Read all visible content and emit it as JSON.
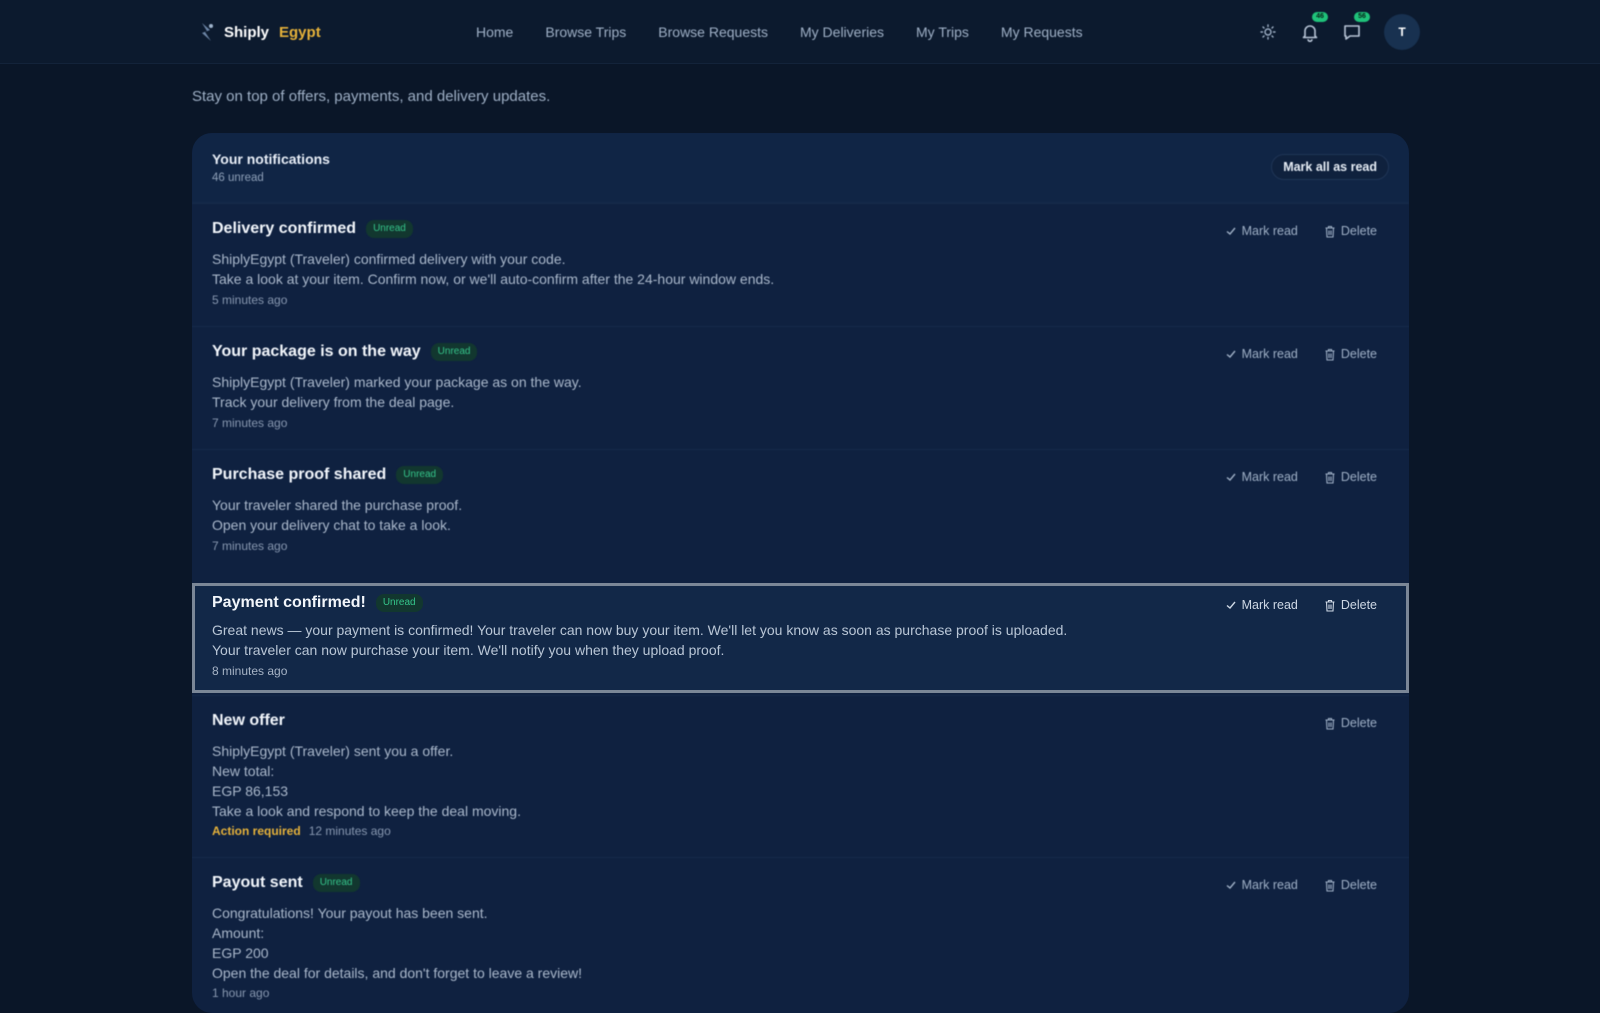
{
  "brand": {
    "name": "Shiply",
    "accent": "Egypt"
  },
  "nav": [
    "Home",
    "Browse Trips",
    "Browse Requests",
    "My Deliveries",
    "My Trips",
    "My Requests"
  ],
  "header": {
    "notification_count": "46",
    "message_count": "56",
    "avatar_initial": "T"
  },
  "page": {
    "subtitle": "Stay on top of offers, payments, and delivery updates."
  },
  "panel": {
    "title": "Your notifications",
    "unread_summary": "46 unread",
    "mark_all_label": "Mark all as read"
  },
  "labels": {
    "mark_read": "Mark read",
    "delete": "Delete",
    "unread": "Unread",
    "action_required": "Action required"
  },
  "notifications": [
    {
      "title": "Delivery confirmed",
      "unread": true,
      "lines": [
        "ShiplyEgypt (Traveler) confirmed delivery with your code.",
        "Take a look at your item. Confirm now, or we'll auto-confirm after the 24-hour window ends."
      ],
      "time": "5 minutes ago"
    },
    {
      "title": "Your package is on the way",
      "unread": true,
      "lines": [
        "ShiplyEgypt (Traveler) marked your package as on the way.",
        "Track your delivery from the deal page."
      ],
      "time": "7 minutes ago"
    },
    {
      "title": "Purchase proof shared",
      "unread": true,
      "lines": [
        "Your traveler shared the purchase proof.",
        "Open your delivery chat to take a look."
      ],
      "time": "7 minutes ago"
    },
    {
      "title": "Payment confirmed!",
      "unread": true,
      "lines": [
        "Great news — your payment is confirmed! Your traveler can now buy your item. We'll let you know as soon as purchase proof is uploaded.",
        "Your traveler can now purchase your item. We'll notify you when they upload proof."
      ],
      "time": "8 minutes ago"
    },
    {
      "title": "New offer",
      "unread": false,
      "lines": [
        "ShiplyEgypt (Traveler) sent you a offer.",
        "New total:",
        "EGP 86,153",
        "Take a look and respond to keep the deal moving."
      ],
      "time": "12 minutes ago"
    },
    {
      "title": "Payout sent",
      "unread": true,
      "lines": [
        "Congratulations! Your payout has been sent.",
        "Amount:",
        "EGP 200",
        "Open the deal for details, and don't forget to leave a review!"
      ],
      "time": "1 hour ago"
    }
  ],
  "colors": {
    "background": "#0a1628",
    "panel": "#0f2140",
    "brand_accent": "#e6b23a",
    "unread_green": "#35c48a",
    "badge_green": "#1fc27a"
  }
}
